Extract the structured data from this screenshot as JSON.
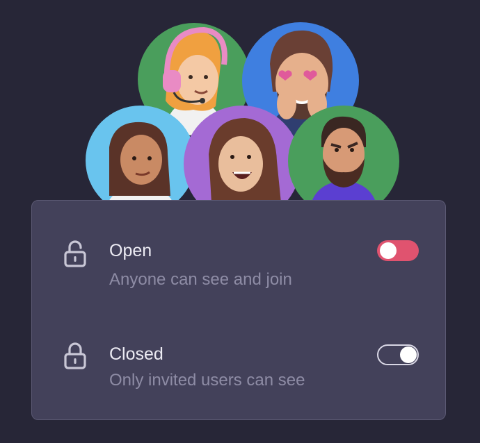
{
  "avatars": [
    {
      "name": "support-agent",
      "color": "#4a9e5c"
    },
    {
      "name": "heart-eyes-man",
      "color": "#3f7fe0"
    },
    {
      "name": "smirk-woman",
      "color": "#69c4ee"
    },
    {
      "name": "laughing-woman",
      "color": "#a46ad4"
    },
    {
      "name": "serious-man",
      "color": "#4a9e5c"
    }
  ],
  "options": [
    {
      "title": "Open",
      "description": "Anyone can see and join",
      "icon": "unlock-icon",
      "enabled": true
    },
    {
      "title": "Closed",
      "description": "Only invited users can see",
      "icon": "lock-icon",
      "enabled": false
    }
  ],
  "colors": {
    "background": "#272637",
    "card": "#43415a",
    "toggle_on": "#e0536f"
  }
}
